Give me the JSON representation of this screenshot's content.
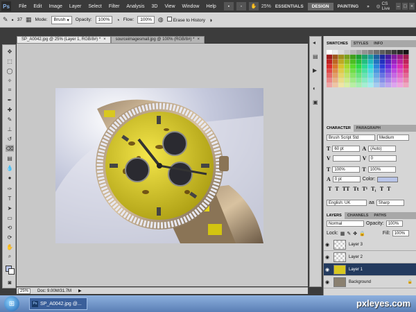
{
  "app": {
    "logo": "Ps"
  },
  "menubar": {
    "items": [
      "File",
      "Edit",
      "Image",
      "Layer",
      "Select",
      "Filter",
      "Analysis",
      "3D",
      "View",
      "Window",
      "Help"
    ],
    "zoom": "25%",
    "workspaces": [
      "ESSENTIALS",
      "DESIGN",
      "PAINTING"
    ],
    "active_workspace": "DESIGN",
    "more": "»",
    "cslive": "CS Live"
  },
  "options": {
    "brush_size": "37",
    "mode_label": "Mode:",
    "mode_value": "Brush",
    "opacity_label": "Opacity:",
    "opacity_value": "100%",
    "flow_label": "Flow:",
    "flow_value": "100%",
    "erase_history": "Erase to History"
  },
  "tabs": [
    {
      "label": "SP_A0042.jpg @ 25% (Layer 1, RGB/8#) *",
      "active": true
    },
    {
      "label": "sourceimagesmall.jpg @ 100% (RGB/8#) *",
      "active": false
    }
  ],
  "status": {
    "zoom": "25%",
    "doc": "Doc: 9.00M/31.7M"
  },
  "panels": {
    "swatch_tabs": [
      "SWATCHES",
      "STYLES",
      "INFO"
    ],
    "char_tabs": [
      "CHARACTER",
      "PARAGRAPH"
    ],
    "font_family": "Brush Script Std",
    "font_style": "Medium",
    "font_size": "60 pt",
    "leading": "(Auto)",
    "tracking": "0",
    "v_scale": "100%",
    "h_scale": "100%",
    "baseline": "0 pt",
    "color_label": "Color:",
    "language": "English: UK",
    "aa_label": "aa",
    "antialias": "Sharp",
    "layer_tabs": [
      "LAYERS",
      "CHANNELS",
      "PATHS"
    ],
    "blend": "Normal",
    "opacity_label": "Opacity:",
    "opacity": "100%",
    "lock_label": "Lock:",
    "fill_label": "Fill:",
    "fill": "100%",
    "layers": [
      "Layer 3",
      "Layer 2",
      "Layer 1",
      "Background"
    ]
  },
  "taskbar": {
    "item": "SP_A0042.jpg @..."
  },
  "watermark": "pxleyes.com"
}
